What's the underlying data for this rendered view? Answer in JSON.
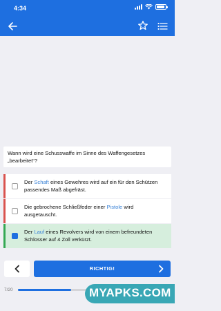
{
  "status": {
    "time": "4:34"
  },
  "question": {
    "text": "Wann wird eine Schusswaffe im Sinne des Waffengesetzes „bearbeitet“?"
  },
  "answers": [
    {
      "state": "wrong",
      "pre": "Der ",
      "hl": "Schaft",
      "post": " eines Gewehres wird auf ein für den Schützen passendes Maß abgefräst."
    },
    {
      "state": "wrong",
      "pre": "Die gebrochene Schließfeder einer ",
      "hl": "Pistole",
      "post": " wird ausgetauscht."
    },
    {
      "state": "correct",
      "pre": "Der ",
      "hl": "Lauf",
      "post": " eines Revolvers wird von einem befreundeten Schlosser auf 4 Zoll verkürzt."
    }
  ],
  "buttons": {
    "check_label": "RICHTIG!"
  },
  "progress": {
    "label": "7/20",
    "fraction": 0.35
  },
  "watermark": {
    "text": "MYAPKS.COM"
  },
  "colors": {
    "brand_blue": "#1e6fe0",
    "correct_bg": "#d6eedd",
    "correct_bar": "#34a853",
    "wrong_bar": "#d9534f",
    "link": "#3a82d6",
    "watermark": "#39a7b5"
  }
}
